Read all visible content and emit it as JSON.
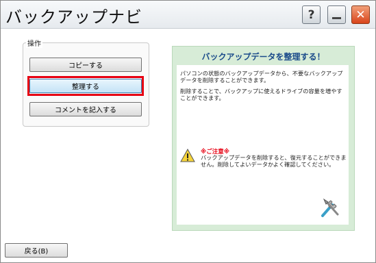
{
  "window": {
    "title": "バックアップナビ",
    "help_label": "?",
    "close_label": "✕"
  },
  "operations": {
    "group_label": "操作",
    "copy_label": "コピーする",
    "organize_label": "整理する",
    "comment_label": "コメントを記入する"
  },
  "panel": {
    "title": "バックアップデータを整理する！",
    "desc1": "パソコンの状態のバックアップデータから、不要なバックアップデータを削除することができます。",
    "desc2": "削除することで、バックアップに使えるドライブの容量を増やすことができます。",
    "caution_head": "※ご注意※",
    "caution_text": "バックアップデータを削除すると、復元することができません。削除してよいデータかよく確認してください。"
  },
  "footer": {
    "back_label": "戻る(B)"
  },
  "colors": {
    "highlight": "#e60012",
    "panel_bg": "#d7ecd7",
    "panel_title": "#1a4a8a",
    "close_btn": "#d9441a"
  },
  "icons": {
    "help": "help-icon",
    "minimize": "minimize-icon",
    "close": "close-icon",
    "warning": "warning-icon",
    "tools": "tools-icon"
  }
}
